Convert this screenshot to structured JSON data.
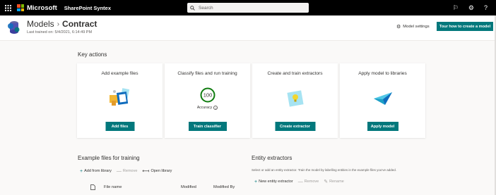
{
  "suite_bar": {
    "brand": "Microsoft",
    "app_name": "SharePoint Syntex",
    "search_placeholder": "Search",
    "icons": [
      "waffle-icon",
      "flag-icon",
      "gear-icon",
      "help-icon"
    ]
  },
  "header": {
    "crumb_parent": "Models",
    "crumb_separator": "›",
    "crumb_current": "Contract",
    "last_trained": "Last trained on: 5/4/2021, 6:14:49 PM",
    "model_settings_label": "Model settings",
    "tour_button_label": "Tour how to create a model"
  },
  "key_actions": {
    "title": "Key actions",
    "cards": [
      {
        "title": "Add example files",
        "button": "Add files"
      },
      {
        "title": "Classify files and run training",
        "button": "Train classifier",
        "accuracy_value": "100",
        "accuracy_label": "Accuracy"
      },
      {
        "title": "Create and train extractors",
        "button": "Create extractor"
      },
      {
        "title": "Apply model to libraries",
        "button": "Apply model"
      }
    ]
  },
  "example_files": {
    "title": "Example files for training",
    "toolbar": {
      "add_from_library": "Add from library",
      "remove": "Remove",
      "open_library": "Open library"
    },
    "columns": {
      "file_name": "File name",
      "modified": "Modified",
      "modified_by": "Modified By"
    }
  },
  "entity_extractors": {
    "title": "Entity extractors",
    "description": "Select or add an entity extractor. Train the model by labelling entities in the example files you've added.",
    "toolbar": {
      "new_entity_extractor": "New entity extractor",
      "remove": "Remove",
      "rename": "Rename"
    }
  },
  "colors": {
    "accent": "#03787c",
    "suite_bar": "#000000",
    "success_ring": "#107c10",
    "page_bg": "#faf9f8"
  }
}
